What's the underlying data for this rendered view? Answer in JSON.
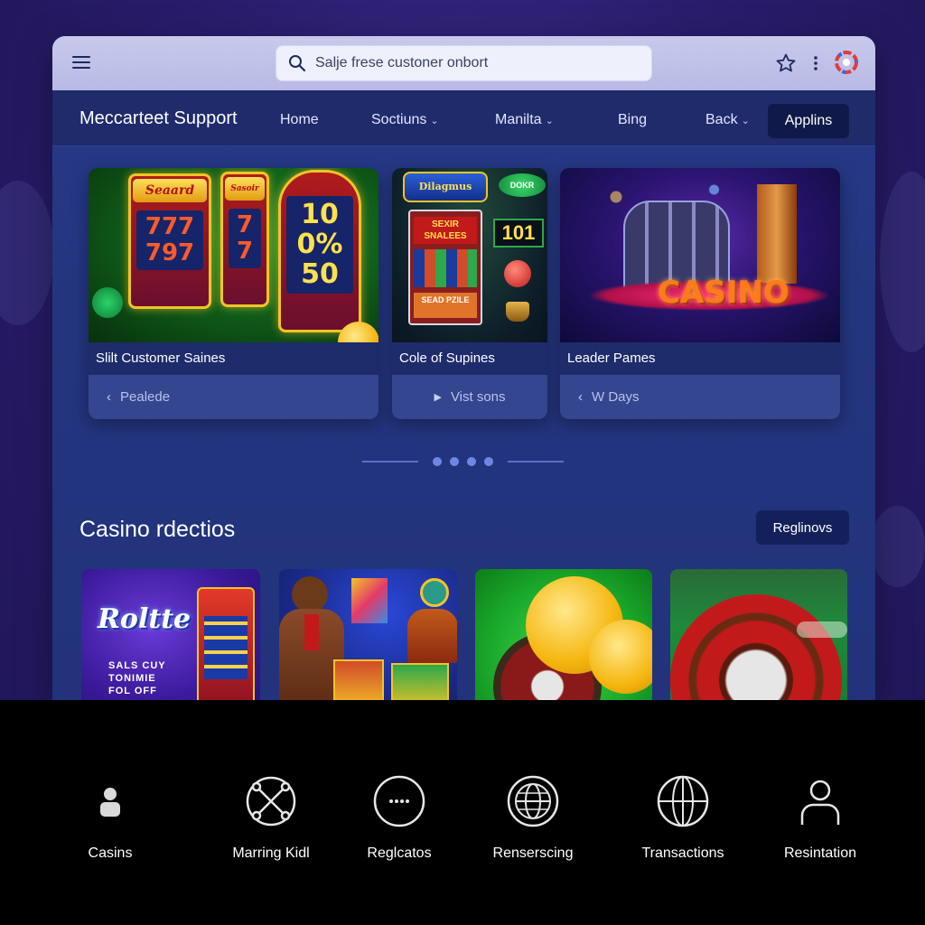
{
  "browser": {
    "search_placeholder": "Salje frese custoner onbort",
    "icons": [
      "menu-icon",
      "search-icon",
      "star-icon",
      "more-vertical-icon",
      "brand-icon"
    ]
  },
  "nav": {
    "site_title": "Meccarteet Support",
    "items": [
      {
        "label": "Home",
        "has_dropdown": false
      },
      {
        "label": "Soctiuns",
        "has_dropdown": true
      },
      {
        "label": "Manilta",
        "has_dropdown": true
      },
      {
        "label": "Bing",
        "has_dropdown": false
      },
      {
        "label": "Back",
        "has_dropdown": true
      }
    ],
    "cta_label": "Applins"
  },
  "featured": [
    {
      "caption": "Slilt Customer Saines",
      "action": "Pealede",
      "action_icon": "chevron-left-icon",
      "art": {
        "reel1": "Seaard",
        "reel1_screen": "777\n797",
        "reel2": "Sasoir",
        "reel2_screen": "7\n7",
        "reel3_screen": "10\n0%\n50"
      }
    },
    {
      "caption": "Cole of Supines",
      "action": "Vist sons",
      "action_icon": "play-icon",
      "art": {
        "marquee": "Dilagmus",
        "panel": "SEXIR SNALEES",
        "counter": "101",
        "badge": "DOKR",
        "plate": "SEAD PZILE"
      }
    },
    {
      "caption": "Leader Pames",
      "action": "W Days",
      "action_icon": "chevron-left-icon",
      "art": {
        "sign": "CASINO"
      }
    }
  ],
  "carousel": {
    "dot_count": 4,
    "active_index": 0
  },
  "section": {
    "title": "Casino rdectios",
    "button_label": "Reglinovs"
  },
  "tiles": [
    {
      "name": "roulette-promo",
      "logo_text": "Roltte",
      "promo_text": "SALS CUY\nTONIMIE\nFOL OFF"
    },
    {
      "name": "live-dealer"
    },
    {
      "name": "coins-roulette"
    },
    {
      "name": "roulette-wheel"
    }
  ],
  "dock": [
    {
      "label": "Casins",
      "icon": "person-icon"
    },
    {
      "label": "Marring Kidl",
      "icon": "network-icon"
    },
    {
      "label": "Reglcatos",
      "icon": "more-horizontal-icon"
    },
    {
      "label": "Renserscing",
      "icon": "globe-icon"
    },
    {
      "label": "Transactions",
      "icon": "globe-grid-icon"
    },
    {
      "label": "Resintation",
      "icon": "user-outline-icon"
    }
  ],
  "colors": {
    "background": "#2a1d6e",
    "window": "#24357f",
    "nav": "#1f2b6b",
    "cta": "#0f1a4a",
    "dock": "#000000"
  }
}
